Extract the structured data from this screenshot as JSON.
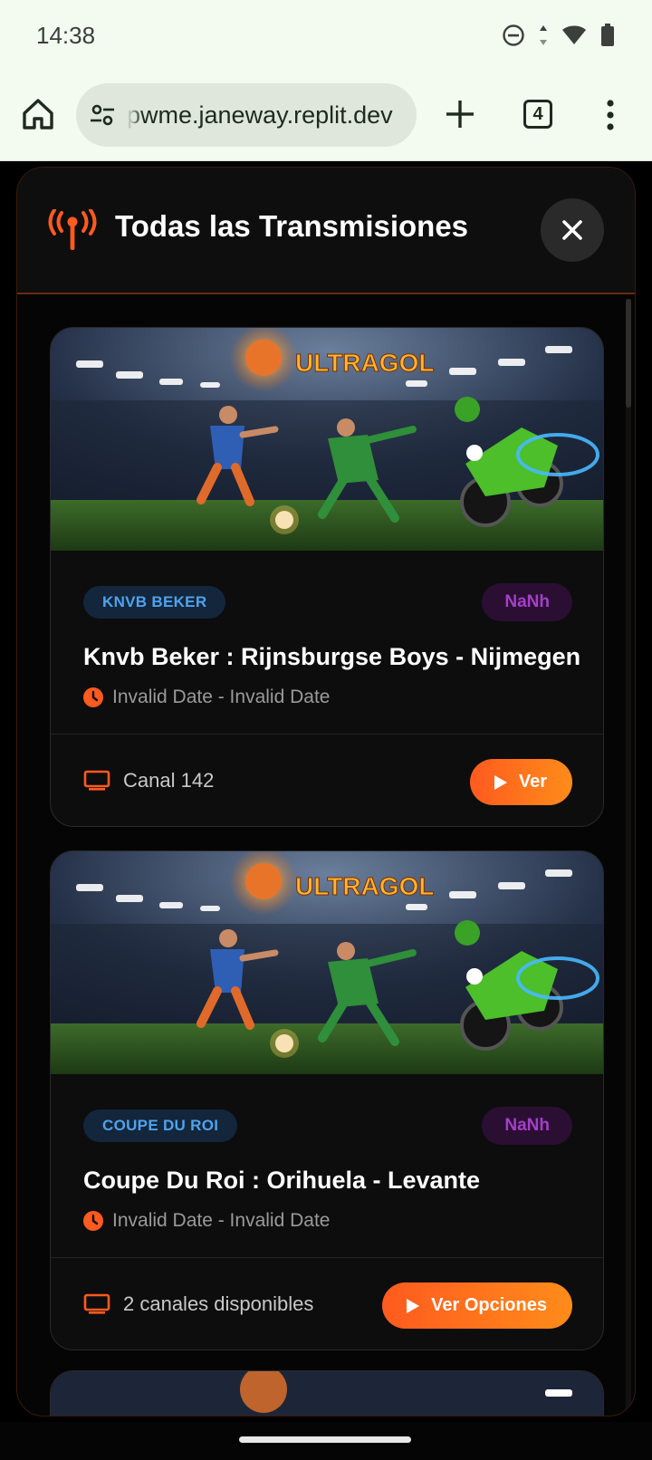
{
  "status_bar": {
    "time": "14:38",
    "icons": [
      "do-not-disturb-icon",
      "data-arrows-icon",
      "wifi-icon",
      "battery-icon"
    ]
  },
  "browser": {
    "url": "pwme.janeway.replit.dev",
    "tab_count": "4"
  },
  "modal": {
    "title": "Todas las Transmisiones",
    "accent_color": "#ff5a1f"
  },
  "events": [
    {
      "image_brand": "ULTRAGOL",
      "league": "KNVB BEKER",
      "time_badge": "NaNh",
      "title": "Knvb Beker : Rijnsburgse Boys - Nijmegen",
      "date": "Invalid Date - Invalid Date",
      "channel": "Canal 142",
      "action": "Ver"
    },
    {
      "image_brand": "ULTRAGOL",
      "league": "COUPE DU ROI",
      "time_badge": "NaNh",
      "title": "Coupe Du Roi : Orihuela - Levante",
      "date": "Invalid Date - Invalid Date",
      "channel": "2 canales disponibles",
      "action": "Ver Opciones"
    }
  ]
}
